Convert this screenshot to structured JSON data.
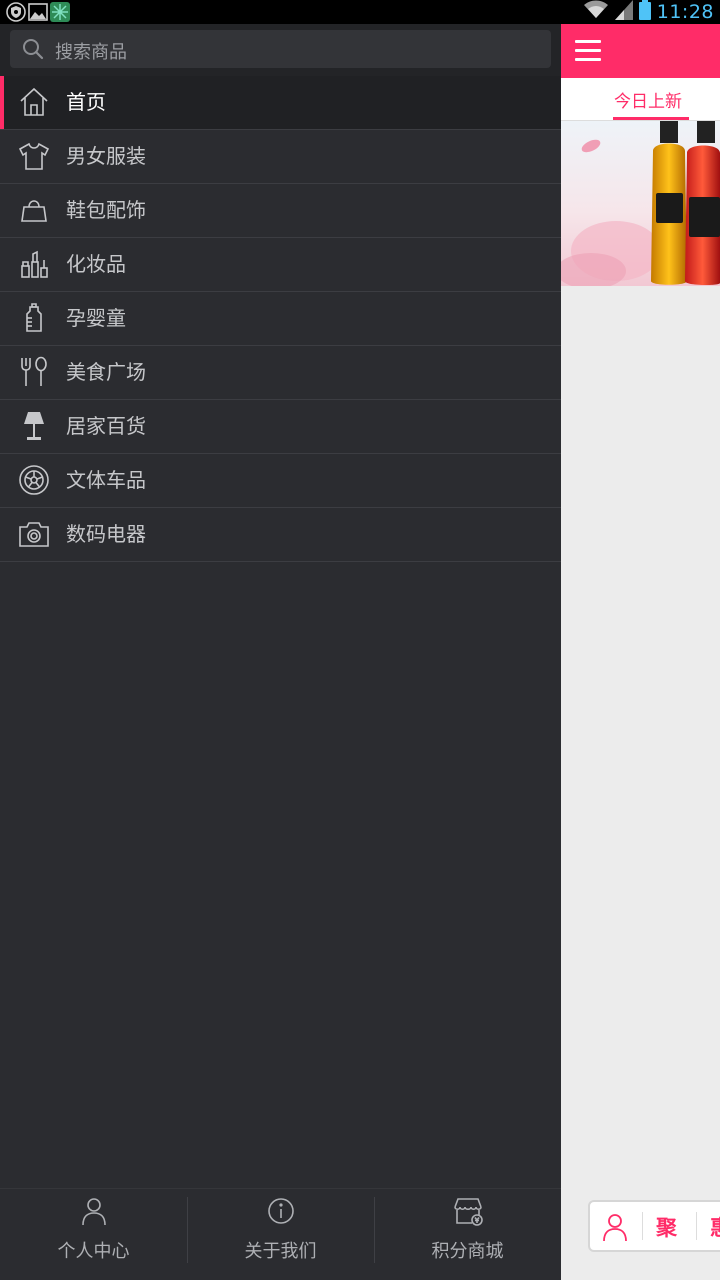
{
  "status_bar": {
    "time": "11:28",
    "left_icons": [
      "shield-icon",
      "gallery-icon",
      "app-icon"
    ],
    "right_icons": [
      "wifi-icon",
      "signal-icon",
      "battery-icon"
    ],
    "time_color": "#4fc3f7"
  },
  "drawer": {
    "search": {
      "placeholder": "搜索商品",
      "icon": "search-icon"
    },
    "menu": [
      {
        "label": "首页",
        "icon": "home-icon",
        "active": true
      },
      {
        "label": "男女服装",
        "icon": "tshirt-icon"
      },
      {
        "label": "鞋包配饰",
        "icon": "bag-icon"
      },
      {
        "label": "化妆品",
        "icon": "cosmetics-icon"
      },
      {
        "label": "孕婴童",
        "icon": "baby-bottle-icon"
      },
      {
        "label": "美食广场",
        "icon": "fork-spoon-icon"
      },
      {
        "label": "居家百货",
        "icon": "lamp-icon"
      },
      {
        "label": "文体车品",
        "icon": "wheel-icon"
      },
      {
        "label": "数码电器",
        "icon": "camera-icon"
      }
    ],
    "bottom_tabs": [
      {
        "label": "个人中心",
        "icon": "user-icon"
      },
      {
        "label": "关于我们",
        "icon": "info-icon"
      },
      {
        "label": "积分商城",
        "icon": "store-icon"
      }
    ]
  },
  "main": {
    "menu_icon": "hamburger-icon",
    "tab": "今日上新",
    "float_bar": {
      "icon": "user-icon",
      "text1": "聚",
      "text2": "惠"
    }
  },
  "colors": {
    "accent": "#ff2c68",
    "drawer_bg": "#2b2c30",
    "active_bg": "#202124",
    "text": "#c6c7ca"
  }
}
